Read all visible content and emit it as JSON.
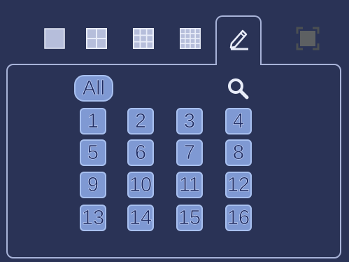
{
  "toolbar": {
    "split_buttons": [
      {
        "icon": "single-view-icon",
        "layout": "1x1"
      },
      {
        "icon": "quad-view-icon",
        "layout": "2x2"
      },
      {
        "icon": "nine-view-icon",
        "layout": "3x3"
      },
      {
        "icon": "sixteen-view-icon",
        "layout": "4x4"
      }
    ],
    "active_tab_icon": "edit-pencil-icon",
    "fullscreen_icon": "fullscreen-icon"
  },
  "channels": {
    "all_label": "All",
    "search_icon": "search-icon",
    "items": [
      "1",
      "2",
      "3",
      "4",
      "5",
      "6",
      "7",
      "8",
      "9",
      "10",
      "11",
      "12",
      "13",
      "14",
      "15",
      "16"
    ]
  },
  "colors": {
    "background": "#2a3356",
    "border": "#a8b3d8",
    "button_fill": "#7f99d3",
    "button_text": "#1e2c63"
  }
}
